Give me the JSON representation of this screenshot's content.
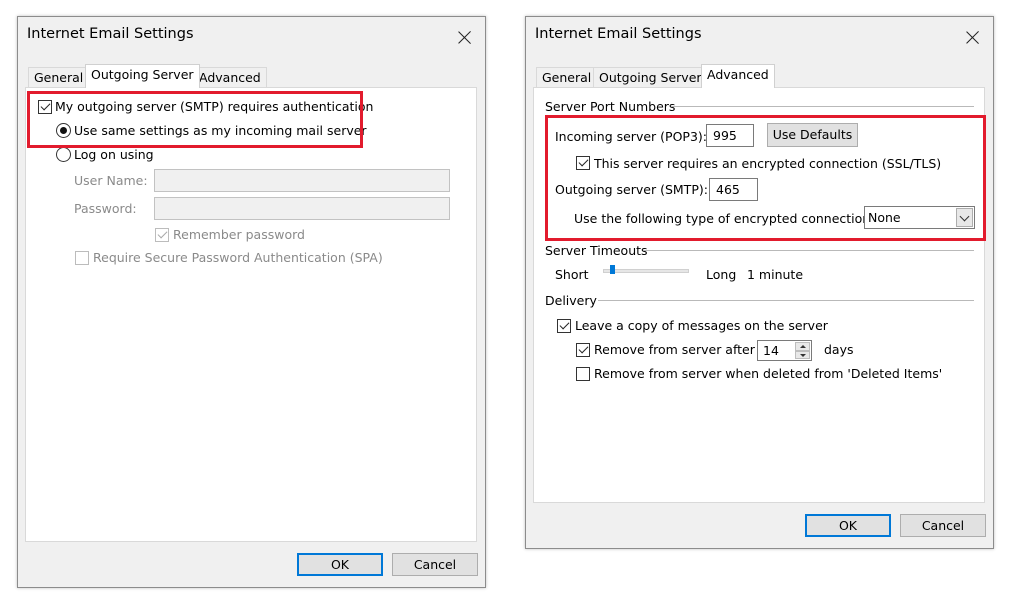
{
  "left_dialog": {
    "title": "Internet Email Settings",
    "tabs": [
      "General",
      "Outgoing Server",
      "Advanced"
    ],
    "active_tab": "Outgoing Server",
    "smtp_auth_label": "My outgoing server (SMTP) requires authentication",
    "smtp_auth_checked": true,
    "same_settings_label": "Use same settings as my incoming mail server",
    "logon_label": "Log on using",
    "username_label": "User Name:",
    "username_value": "",
    "password_label": "Password:",
    "password_value": "",
    "remember_password_label": "Remember password",
    "spa_label": "Require Secure Password Authentication (SPA)",
    "ok_label": "OK",
    "cancel_label": "Cancel"
  },
  "right_dialog": {
    "title": "Internet Email Settings",
    "tabs": [
      "General",
      "Outgoing Server",
      "Advanced"
    ],
    "active_tab": "Advanced",
    "server_ports_heading": "Server Port Numbers",
    "incoming_label": "Incoming server (POP3):",
    "incoming_port": "995",
    "use_defaults_label": "Use Defaults",
    "ssl_label": "This server requires an encrypted connection (SSL/TLS)",
    "outgoing_label": "Outgoing server (SMTP):",
    "outgoing_port": "465",
    "encryption_type_label": "Use the following type of encrypted connection:",
    "encryption_type_value": "None",
    "timeouts_heading": "Server Timeouts",
    "short_label": "Short",
    "long_label": "Long",
    "timeout_value": "1 minute",
    "timeout_level_fraction": 0.1,
    "delivery_heading": "Delivery",
    "leave_copy_label": "Leave a copy of messages on the server",
    "remove_after_label": "Remove from server after",
    "remove_after_days": "14",
    "days_label": "days",
    "remove_deleted_label": "Remove from server when deleted from 'Deleted Items'",
    "ok_label": "OK",
    "cancel_label": "Cancel"
  },
  "colors": {
    "highlight": "#e21b2d",
    "accent": "#0078d7",
    "dialog_bg": "#f0f0f0"
  },
  "icons": [
    "close-icon",
    "checkbox-checked-icon",
    "radio-selected-icon",
    "dropdown-arrow-icon",
    "spinner-arrows-icon"
  ]
}
